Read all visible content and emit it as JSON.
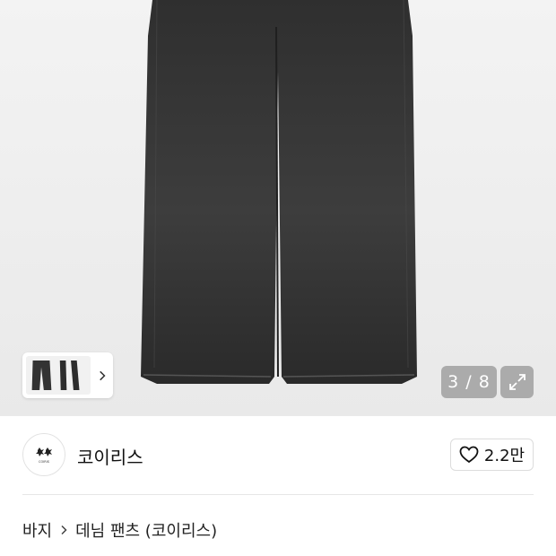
{
  "gallery": {
    "counter": "3 / 8",
    "icons": {
      "thumb_next": "chevron-right-icon",
      "expand": "expand-icon"
    }
  },
  "brand": {
    "name": "코이리스",
    "logo_text": "COIRIS",
    "like_count": "2.2만",
    "like_icon": "heart-outline-icon"
  },
  "breadcrumb": {
    "items": [
      "바지",
      "데님 팬츠 (코이리스)"
    ],
    "separator_icon": "chevron-right-icon"
  }
}
